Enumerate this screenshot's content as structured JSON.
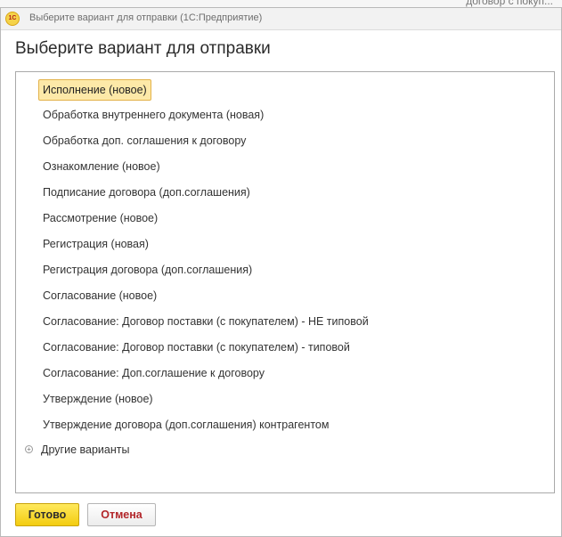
{
  "background": {
    "fragment_text": "договор с покуп..."
  },
  "window": {
    "title": "Выберите вариант для отправки  (1С:Предприятие)"
  },
  "form": {
    "title": "Выберите вариант для отправки"
  },
  "options": [
    {
      "label": "Исполнение (новое)",
      "selected": true
    },
    {
      "label": "Обработка внутреннего документа (новая)",
      "selected": false
    },
    {
      "label": "Обработка доп. соглашения к договору",
      "selected": false
    },
    {
      "label": "Ознакомление (новое)",
      "selected": false
    },
    {
      "label": "Подписание договора (доп.соглашения)",
      "selected": false
    },
    {
      "label": "Рассмотрение (новое)",
      "selected": false
    },
    {
      "label": "Регистрация (новая)",
      "selected": false
    },
    {
      "label": "Регистрация договора (доп.соглашения)",
      "selected": false
    },
    {
      "label": "Согласование (новое)",
      "selected": false
    },
    {
      "label": "Согласование: Договор поставки (с покупателем) - НЕ типовой",
      "selected": false
    },
    {
      "label": "Согласование: Договор поставки (с покупателем) - типовой",
      "selected": false
    },
    {
      "label": "Согласование: Доп.соглашение к договору",
      "selected": false
    },
    {
      "label": "Утверждение (новое)",
      "selected": false
    },
    {
      "label": "Утверждение договора (доп.соглашения) контрагентом",
      "selected": false
    }
  ],
  "other_group": {
    "label": "Другие варианты",
    "icon": "expand-plus-icon",
    "expanded": false
  },
  "buttons": {
    "ok": "Готово",
    "cancel": "Отмена"
  },
  "colors": {
    "selected_fill": "#fde9a8",
    "selected_border": "#e3b24a",
    "ok_button": "#f3cc10",
    "cancel_text": "#b2262a"
  }
}
